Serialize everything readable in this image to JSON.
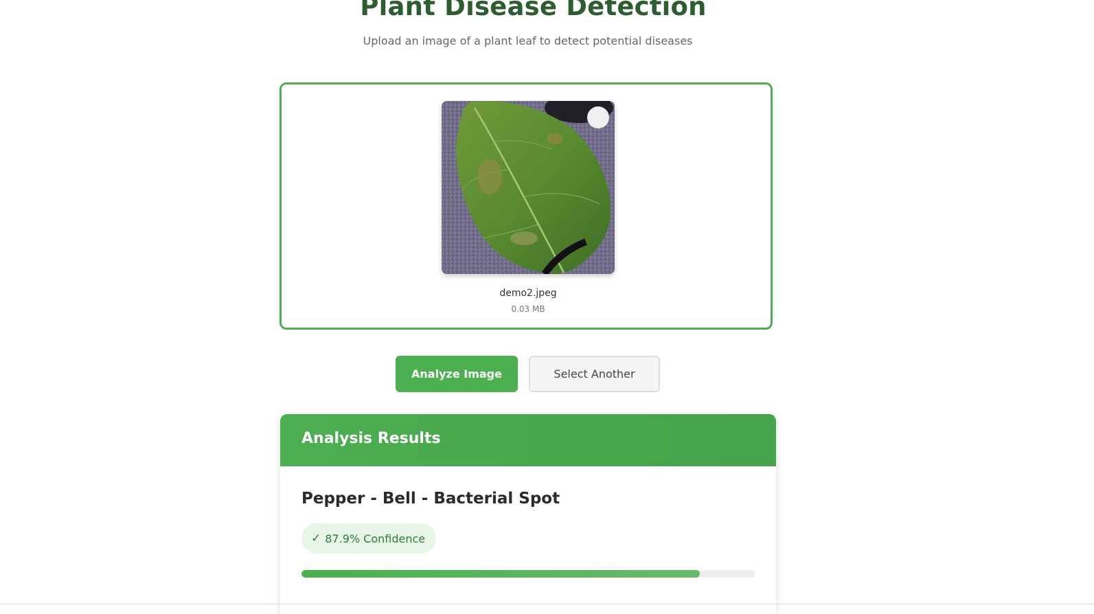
{
  "header": {
    "title": "Plant Disease Detection",
    "subtitle": "Upload an image of a plant leaf to detect potential diseases"
  },
  "upload": {
    "file_name": "demo2.jpeg",
    "file_size": "0.03 MB",
    "remove_icon": "close-icon"
  },
  "actions": {
    "analyze_label": "Analyze Image",
    "select_label": "Select Another"
  },
  "results": {
    "title": "Analysis Results",
    "disease": "Pepper - Bell - Bacterial Spot",
    "confidence_icon": "✓",
    "confidence_text": "87.9% Confidence",
    "confidence_value": 0.879
  },
  "colors": {
    "primary": "#4caf50",
    "title": "#2e5d2f",
    "badge_bg": "#e8f5e9",
    "badge_text": "#2e7d32"
  }
}
